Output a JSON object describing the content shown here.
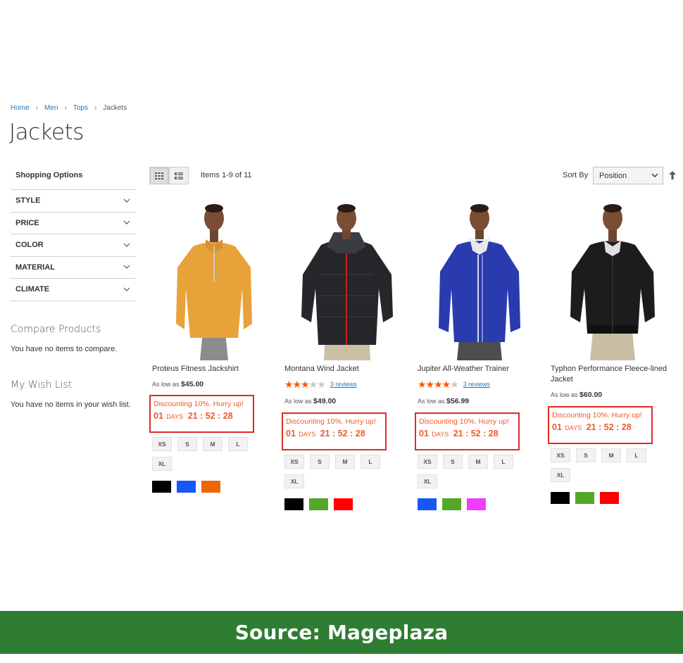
{
  "breadcrumb": [
    {
      "label": "Home"
    },
    {
      "label": "Men"
    },
    {
      "label": "Tops"
    },
    {
      "label": "Jackets"
    }
  ],
  "page_title": "Jackets",
  "sidebar": {
    "shopping_title": "Shopping Options",
    "filters": [
      "STYLE",
      "PRICE",
      "COLOR",
      "MATERIAL",
      "CLIMATE"
    ],
    "compare_title": "Compare Products",
    "compare_text": "You have no items to compare.",
    "wishlist_title": "My Wish List",
    "wishlist_text": "You have no items in your wish list."
  },
  "toolbar": {
    "item_count": "Items 1-9 of 11",
    "sort_label": "Sort By",
    "sort_value": "Position"
  },
  "products": [
    {
      "name": "Proteus Fitness Jackshirt",
      "price_prefix": "As low as",
      "price": "$45.00",
      "promo_text": "Discounting 10%. Hurry up!",
      "countdown_days": "01",
      "days_label": "DAYS",
      "countdown_time": "21 : 52 : 28",
      "sizes": [
        "XS",
        "S",
        "M",
        "L",
        "XL"
      ],
      "colors": [
        "#000000",
        "#1857f7",
        "#eb6703"
      ],
      "jacket_color": "#e8a23a"
    },
    {
      "name": "Montana Wind Jacket",
      "rating": 3,
      "reviews": "3 reviews",
      "price_prefix": "As low as",
      "price": "$49.00",
      "promo_text": "Discounting 10%. Hurry up!",
      "countdown_days": "01",
      "days_label": "DAYS",
      "countdown_time": "21 : 52 : 28",
      "sizes": [
        "XS",
        "S",
        "M",
        "L",
        "XL"
      ],
      "colors": [
        "#000000",
        "#53a828",
        "#ff0000"
      ],
      "jacket_color": "#25272b"
    },
    {
      "name": "Jupiter All-Weather Trainer",
      "rating": 4,
      "reviews": "3 reviews",
      "price_prefix": "As low as",
      "price": "$56.99",
      "promo_text": "Discounting 10%. Hurry up!",
      "countdown_days": "01",
      "days_label": "DAYS",
      "countdown_time": "21 : 52 : 28",
      "sizes": [
        "XS",
        "S",
        "M",
        "L",
        "XL"
      ],
      "colors": [
        "#1857f7",
        "#53a828",
        "#ef3dff"
      ],
      "jacket_color": "#2a3bb0"
    },
    {
      "name": "Typhon Performance Fleece-lined Jacket",
      "price_prefix": "As low as",
      "price": "$60.00",
      "promo_text": "Discounting 10%. Hurry up!",
      "countdown_days": "01",
      "days_label": "DAYS",
      "countdown_time": "21 : 52 : 28",
      "sizes": [
        "XS",
        "S",
        "M",
        "L",
        "XL"
      ],
      "colors": [
        "#000000",
        "#53a828",
        "#ff0000"
      ],
      "jacket_color": "#1c1c1e"
    }
  ],
  "source": "Source: Mageplaza"
}
